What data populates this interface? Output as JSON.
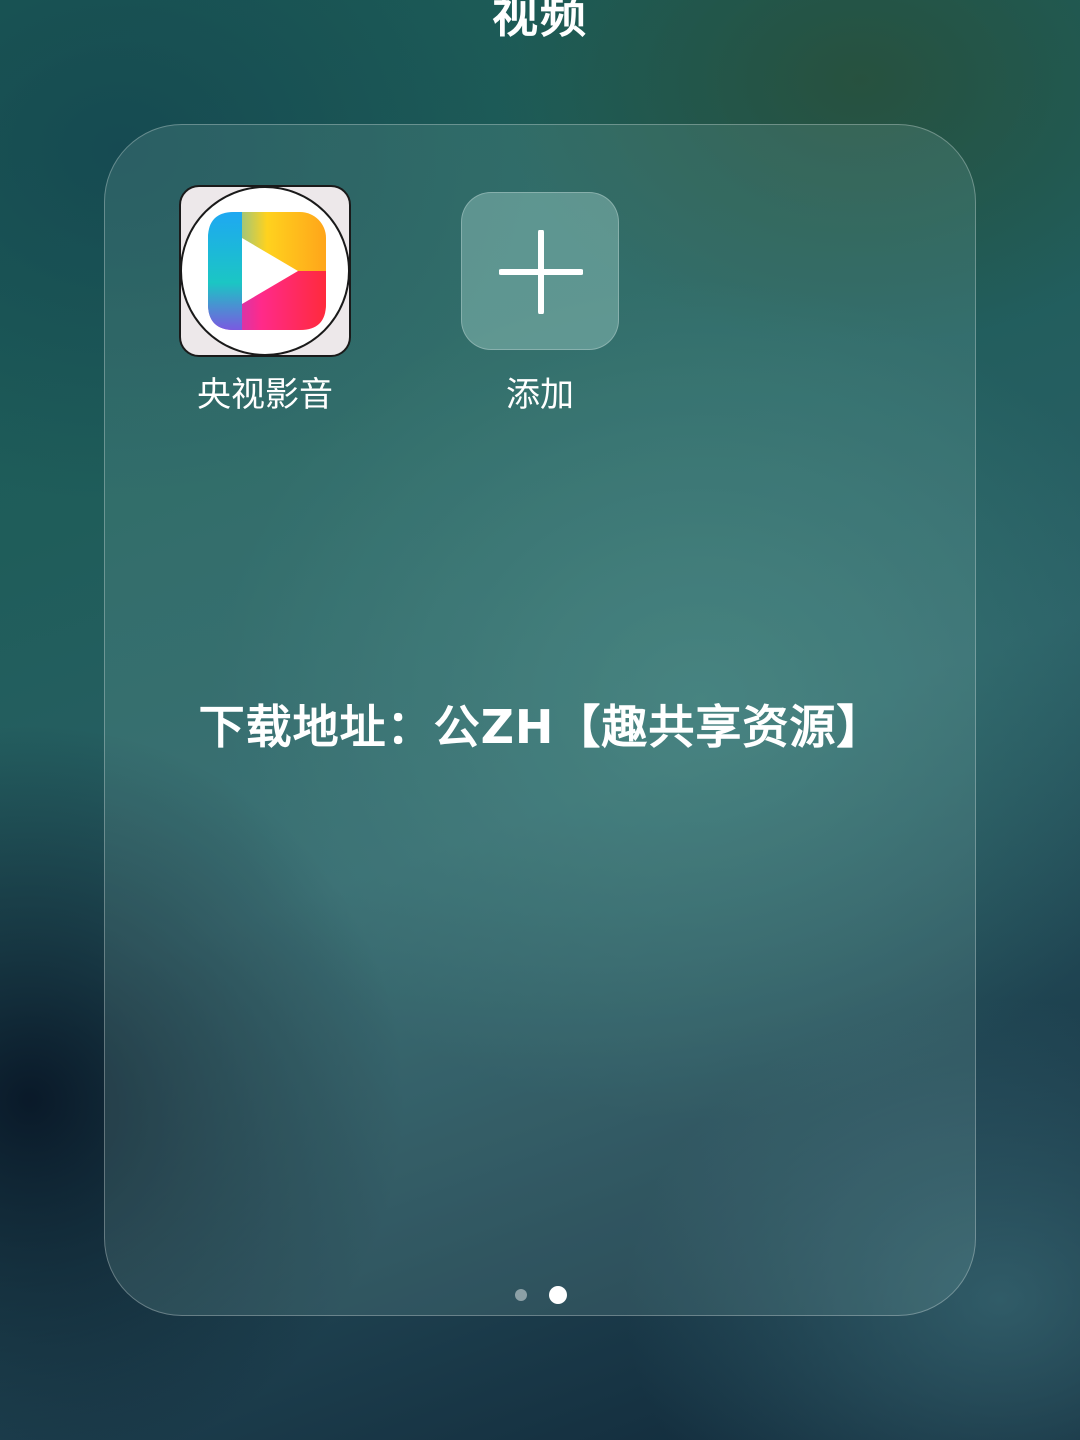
{
  "folder": {
    "title": "视频"
  },
  "apps": [
    {
      "label": "央视影音",
      "icon": "cctv-play-icon"
    },
    {
      "label": "添加",
      "icon": "plus-icon"
    }
  ],
  "overlay": {
    "text": "下载地址：公ZH【趣共享资源】"
  },
  "pagination": {
    "total": 2,
    "current": 2
  },
  "colors": {
    "text": "#ffffff",
    "dot_inactive": "rgba(255,255,255,0.45)",
    "dot_active": "#ffffff"
  }
}
